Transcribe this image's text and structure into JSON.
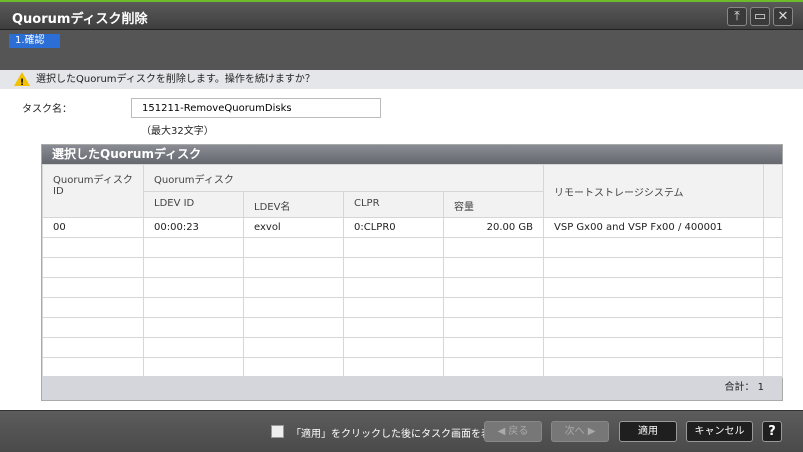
{
  "window": {
    "title": "Quorumディスク削除",
    "controls": [
      "pin-icon",
      "maximize-icon",
      "close-icon"
    ]
  },
  "steps": [
    {
      "label": "1.確認",
      "active": true
    }
  ],
  "warning": {
    "icon": "warning-icon",
    "text": "選択したQuorumディスクを削除します。操作を続けますか？"
  },
  "task": {
    "label": "タスク名：",
    "value": "151211-RemoveQuorumDisks",
    "hint": "（最大32文字）"
  },
  "table": {
    "title": "選択したQuorumディスク",
    "headers": {
      "qid": "Quorumディスク ID",
      "group": "Quorumディスク",
      "ldev_id": "LDEV ID",
      "ldev_name": "LDEV名",
      "clpr": "CLPR",
      "capacity": "容量",
      "remote": "リモートストレージシステム"
    },
    "rows": [
      {
        "qid": "00",
        "ldev_id": "00:00:23",
        "ldev_name": "exvol",
        "clpr": "0:CLPR0",
        "capacity": "20.00 GB",
        "remote": "VSP Gx00 and VSP Fx00 / 400001"
      }
    ],
    "total": "合計：  1"
  },
  "footer": {
    "checkbox_label": "「適用」をクリックした後にタスク画面を表示",
    "checked": false,
    "back": "◀ 戻る",
    "next": "次へ ▶",
    "apply": "適用",
    "cancel": "キャンセル",
    "help": "?"
  }
}
